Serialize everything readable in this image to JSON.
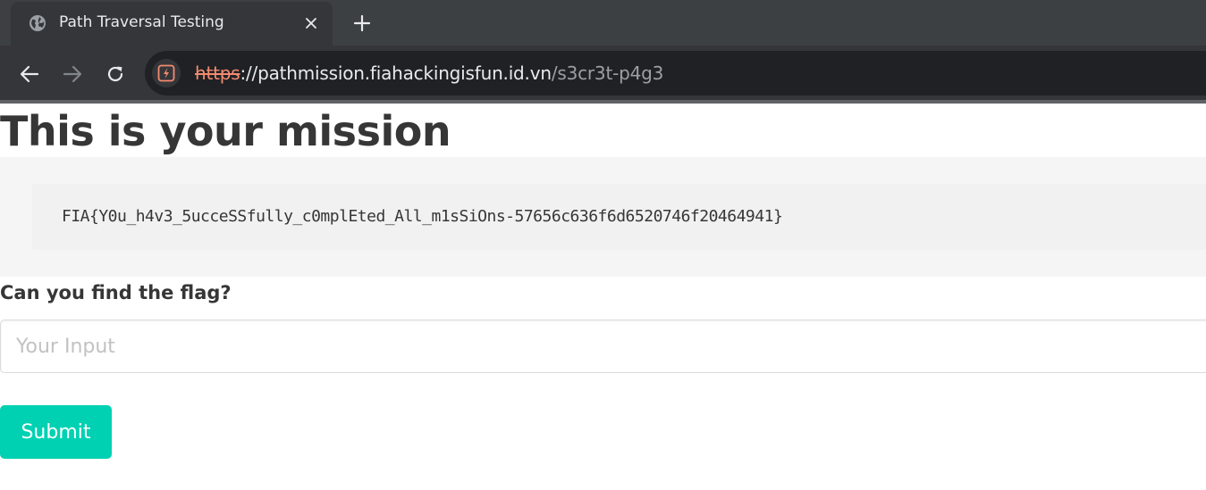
{
  "browser": {
    "tab": {
      "title": "Path Traversal Testing",
      "favicon_icon": "globe-icon",
      "close_icon": "close-icon"
    },
    "new_tab_icon": "plus-icon",
    "nav": {
      "back_icon": "arrow-left-icon",
      "forward_icon": "arrow-right-icon",
      "reload_icon": "reload-icon"
    },
    "address_bar": {
      "security_icon": "not-secure-icon",
      "scheme": "https",
      "separator": "://",
      "host": "pathmission.fiahackingisfun.id.vn",
      "path": "/s3cr3t-p4g3"
    }
  },
  "page": {
    "title": "This is your mission",
    "flag": "FIA{Y0u_h4v3_5ucceSSfully_c0mplEted_All_m1sSiOns-57656c636f6d6520746f20464941}",
    "form": {
      "label": "Can you find the flag?",
      "input_value": "",
      "input_placeholder": "Your Input",
      "submit_label": "Submit"
    }
  },
  "colors": {
    "chrome_dark": "#35363a",
    "tabstrip": "#3c4043",
    "omnibox": "#202124",
    "not_secure_scheme": "#f28b70",
    "submit_button": "#00d1b2",
    "flag_panel": "#f5f5f5",
    "text": "#363636"
  }
}
